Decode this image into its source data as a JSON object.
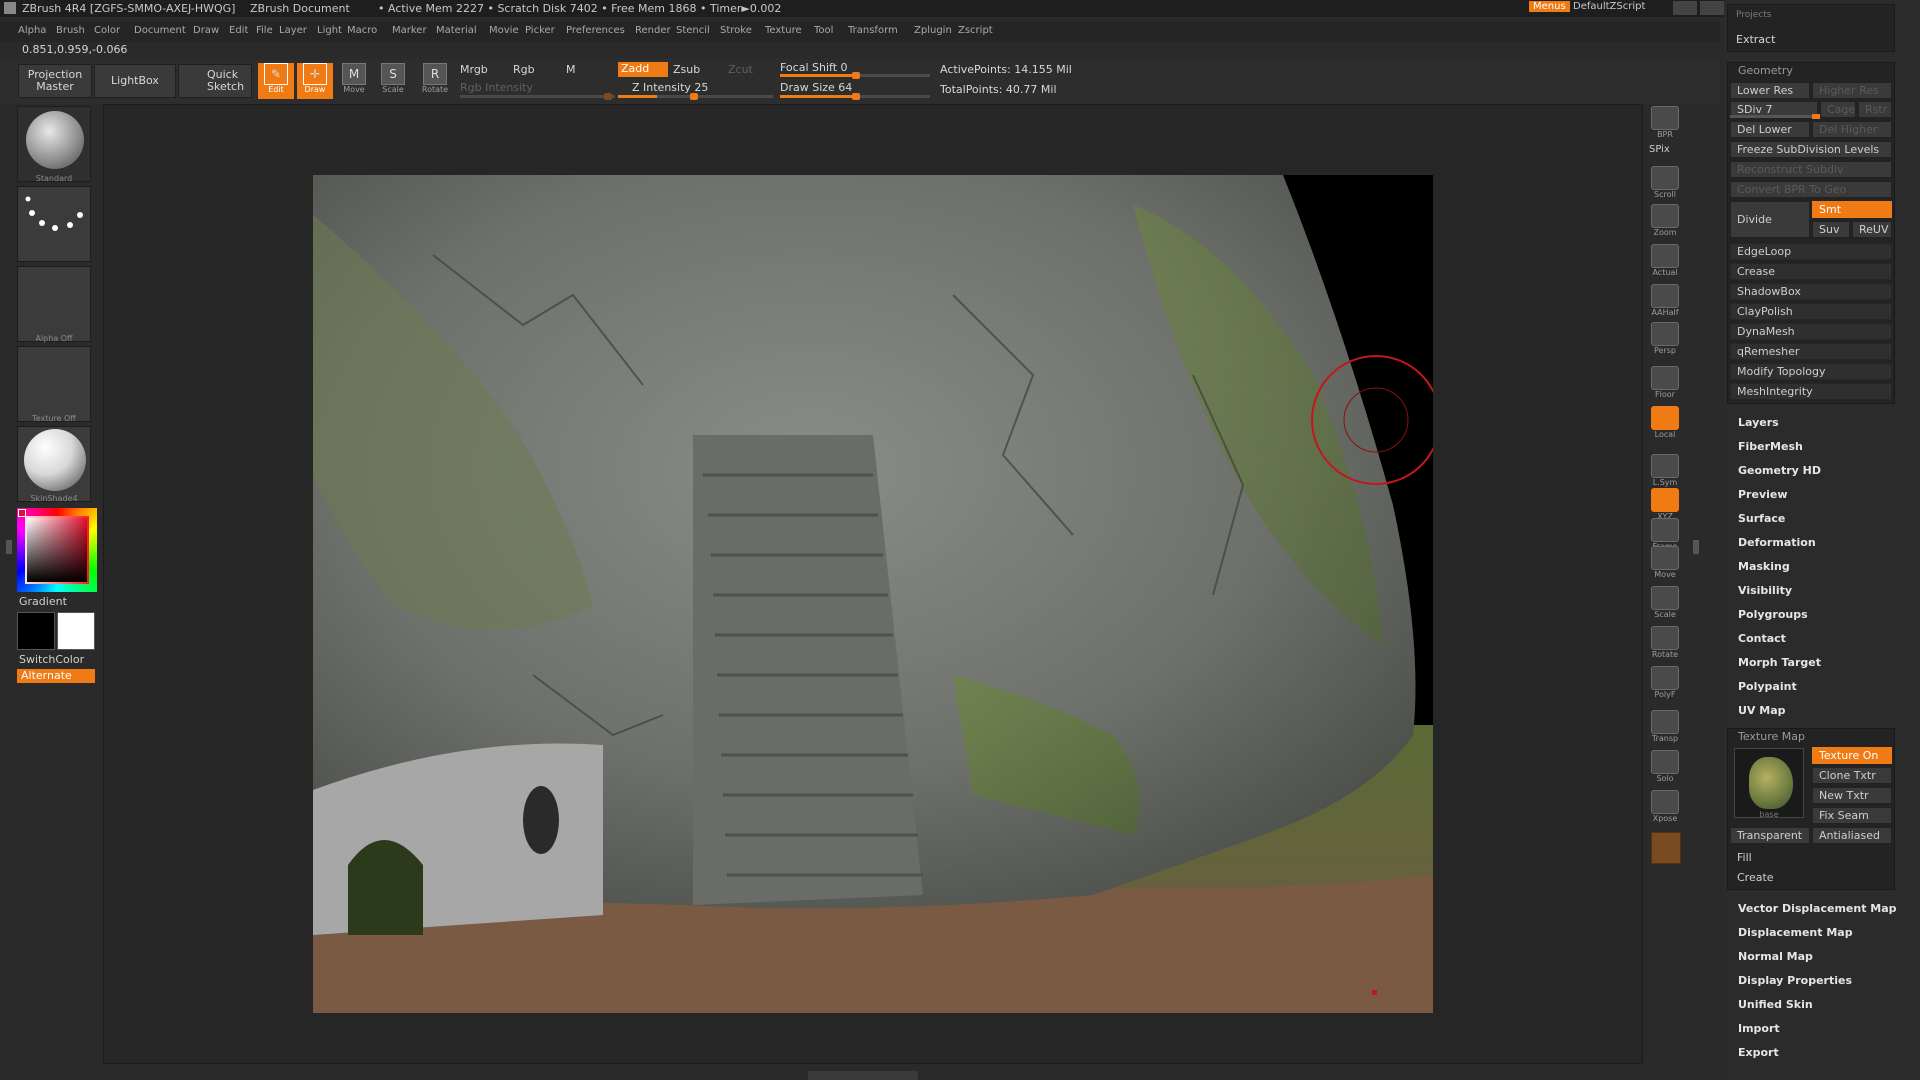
{
  "titlebar": {
    "app": "ZBrush 4R4 [ZGFS-SMMO-AXEJ-HWQG]",
    "doc": "ZBrush Document",
    "mem": "• Active Mem 2227 • Scratch Disk 7402 • Free Mem 1868 • Timer►0.002",
    "menus_btn": "Menus",
    "script": "DefaultZScript"
  },
  "menubar": [
    "Alpha",
    "Brush",
    "Color",
    "Document",
    "Draw",
    "Edit",
    "File",
    "Layer",
    "Light",
    "Macro",
    "Marker",
    "Material",
    "Movie",
    "Picker",
    "Preferences",
    "Render",
    "Stencil",
    "Stroke",
    "Texture",
    "Tool",
    "Transform",
    "Zplugin",
    "Zscript"
  ],
  "coords": "0.851,0.959,-0.066",
  "toolbar": {
    "projection_master": "Projection Master",
    "lightbox": "LightBox",
    "quick_sketch": "Quick Sketch",
    "edit": "Edit",
    "draw": "Draw",
    "move": "Move",
    "scale": "Scale",
    "rotate": "Rotate",
    "mrgb": "Mrgb",
    "rgb": "Rgb",
    "m": "M",
    "rgb_intensity": "Rgb Intensity",
    "zadd": "Zadd",
    "zsub": "Zsub",
    "zcut": "Zcut",
    "z_intensity": "Z Intensity 25",
    "z_intensity_value": 25,
    "focal_shift": "Focal Shift 0",
    "focal_shift_value": 0,
    "draw_size": "Draw Size 64",
    "draw_size_value": 64,
    "active_points": "ActivePoints: 14.155 Mil",
    "total_points": "TotalPoints: 40.77 Mil"
  },
  "leftshelf": {
    "brush": "Standard",
    "stroke": "Dots",
    "alpha": "Alpha Off",
    "texture": "Texture Off",
    "material": "SkinShade4",
    "gradient": "Gradient",
    "switchcolor": "SwitchColor",
    "alternate": "Alternate"
  },
  "rightshelf": [
    {
      "name": "bpr",
      "label": "BPR",
      "icon": "bpr-icon"
    },
    {
      "name": "spix",
      "label": "SPix",
      "icon": "spix-icon"
    },
    {
      "name": "scroll",
      "label": "Scroll",
      "icon": "scroll-icon"
    },
    {
      "name": "zoom",
      "label": "Zoom",
      "icon": "zoom-icon"
    },
    {
      "name": "actual",
      "label": "Actual",
      "icon": "actual-icon"
    },
    {
      "name": "aahalf",
      "label": "AAHalf",
      "icon": "aahalf-icon"
    },
    {
      "name": "persp",
      "label": "Persp",
      "icon": "persp-icon"
    },
    {
      "name": "floor",
      "label": "Floor",
      "icon": "floor-icon"
    },
    {
      "name": "local",
      "label": "Local",
      "icon": "local-icon"
    },
    {
      "name": "lsym",
      "label": "L.Sym",
      "icon": "lsym-icon"
    },
    {
      "name": "xyz",
      "label": "XYZ",
      "icon": "xyz-icon"
    },
    {
      "name": "frame",
      "label": "Frame",
      "icon": "frame-icon"
    },
    {
      "name": "move",
      "label": "Move",
      "icon": "move-icon"
    },
    {
      "name": "scale",
      "label": "Scale",
      "icon": "scale-icon"
    },
    {
      "name": "rotate",
      "label": "Rotate",
      "icon": "rotate-icon"
    },
    {
      "name": "polyf",
      "label": "PolyF",
      "icon": "polyf-icon"
    },
    {
      "name": "transp",
      "label": "Transp",
      "icon": "transp-icon"
    },
    {
      "name": "solo",
      "label": "Solo",
      "icon": "solo-icon"
    },
    {
      "name": "xpose",
      "label": "Xpose",
      "icon": "xpose-icon"
    }
  ],
  "panel": {
    "projects": "Projects",
    "extract": "Extract",
    "geometry": "Geometry",
    "lower_res": "Lower Res",
    "higher_res": "Higher Res",
    "sdiv": "SDiv 7",
    "cage": "Cage",
    "rstr": "Rstr",
    "del_lower": "Del Lower",
    "del_higher": "Del Higher",
    "freeze": "Freeze SubDivision Levels",
    "reconstruct": "Reconstruct Subdiv",
    "convert_bpr": "Convert BPR To Geo",
    "divide": "Divide",
    "smt": "Smt",
    "suv": "Suv",
    "reuv": "ReUV",
    "geom_items": [
      "EdgeLoop",
      "Crease",
      "ShadowBox",
      "ClayPolish",
      "DynaMesh",
      "qRemesher",
      "Modify Topology",
      "MeshIntegrity"
    ],
    "sections_a": [
      "Layers",
      "FiberMesh",
      "Geometry HD",
      "Preview",
      "Surface",
      "Deformation",
      "Masking",
      "Visibility",
      "Polygroups",
      "Contact",
      "Morph Target",
      "Polypaint",
      "UV Map"
    ],
    "texture_map": "Texture Map",
    "texture_on": "Texture On",
    "clone_txtr": "Clone Txtr",
    "new_txtr": "New Txtr",
    "fix_seam": "Fix Seam",
    "base": "base",
    "transparent": "Transparent",
    "antialiased": "Antialiased",
    "fill": "Fill",
    "create": "Create",
    "sections_b": [
      "Vector Displacement Map",
      "Displacement Map",
      "Normal Map",
      "Display Properties",
      "Unified Skin",
      "Import",
      "Export"
    ]
  },
  "colors": {
    "accent": "#f07a14",
    "bg": "#2a2a2a",
    "panel": "#2b2b2b",
    "cursor": "#c4161c"
  }
}
